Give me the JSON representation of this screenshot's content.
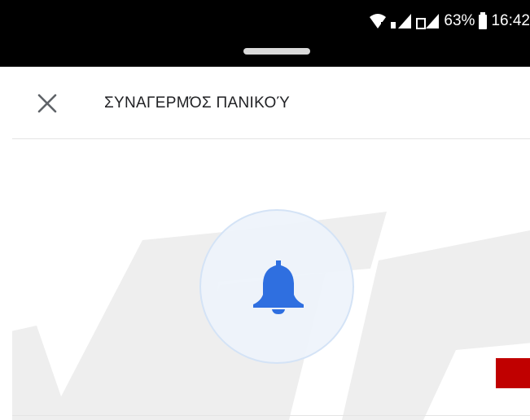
{
  "status_bar": {
    "battery_percent": "63%",
    "time": "16:42"
  },
  "sheet": {
    "title": "ΣΥΝΑΓΕΡΜΌΣ ΠΑΝΙΚΟΎ",
    "close_icon": "close-icon"
  },
  "alarm": {
    "icon": "bell-icon",
    "accent_color": "#2f6fe0"
  },
  "watermark": {
    "colors": [
      "#eeeeee",
      "#c00000"
    ]
  }
}
